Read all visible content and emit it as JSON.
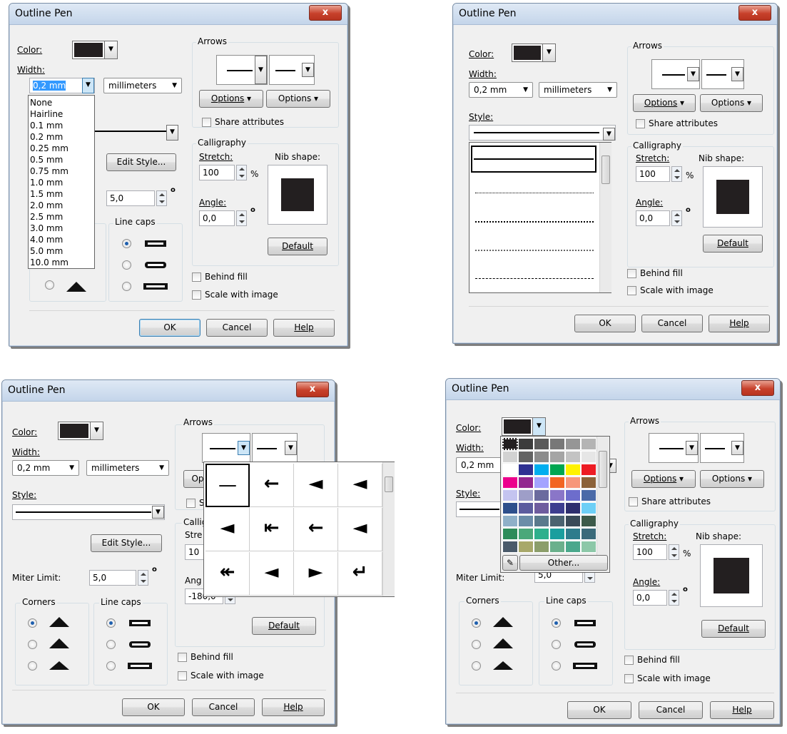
{
  "panels": {
    "width_list": {
      "title": "Outline Pen",
      "color_label": "Color:",
      "width_label": "Width:",
      "width_value": "0,2 mm",
      "units": "millimeters",
      "width_options": [
        "None",
        "Hairline",
        "0.1 mm",
        "0.2 mm",
        "0.25 mm",
        "0.5 mm",
        "0.75 mm",
        "1.0 mm",
        "1.5 mm",
        "2.0 mm",
        "2.5 mm",
        "3.0 mm",
        "4.0 mm",
        "5.0 mm",
        "10.0 mm"
      ],
      "edit_style": "Edit Style...",
      "miter_value": "5,0",
      "line_caps": "Line caps",
      "arrows": "Arrows",
      "options1": "Options",
      "options2": "Options",
      "share": "Share attributes",
      "calligraphy": "Calligraphy",
      "stretch": "Stretch:",
      "stretch_value": "100",
      "percent": "%",
      "nib_shape": "Nib shape:",
      "angle": "Angle:",
      "angle_value": "0,0",
      "degree": "o",
      "default": "Default",
      "behind_fill": "Behind fill",
      "scale": "Scale with image",
      "ok": "OK",
      "cancel": "Cancel",
      "help": "Help",
      "close": "x"
    },
    "style_list": {
      "title": "Outline Pen",
      "color_label": "Color:",
      "width_label": "Width:",
      "width_value": "0,2 mm",
      "units": "millimeters",
      "style_label": "Style:",
      "arrows": "Arrows",
      "options1": "Options",
      "options2": "Options",
      "share": "Share attributes",
      "calligraphy": "Calligraphy",
      "stretch": "Stretch:",
      "stretch_value": "100",
      "percent": "%",
      "nib_shape": "Nib shape:",
      "angle": "Angle:",
      "angle_value": "0,0",
      "degree": "o",
      "default": "Default",
      "behind_fill": "Behind fill",
      "scale": "Scale with image",
      "ok": "OK",
      "cancel": "Cancel",
      "help": "Help",
      "close": "x"
    },
    "arrow_picker": {
      "title": "Outline Pen",
      "color_label": "Color:",
      "width_label": "Width:",
      "width_value": "0,2 mm",
      "units": "millimeters",
      "style_label": "Style:",
      "edit_style": "Edit Style...",
      "miter_label": "Miter Limit:",
      "miter_value": "5,0",
      "degree": "o",
      "corners": "Corners",
      "line_caps": "Line caps",
      "arrows": "Arrows",
      "op_partial": "Op",
      "s_partial": "S",
      "calli_partial": "Callig",
      "stre_partial": "Stre",
      "ten_partial": "10",
      "ang_partial": "Ang",
      "angle_value": "-180,0",
      "default": "Default",
      "behind_fill": "Behind fill",
      "scale": "Scale with image",
      "ok": "OK",
      "cancel": "Cancel",
      "help": "Help",
      "close": "x",
      "arrowheads": [
        "—",
        "←",
        "◄",
        "◄",
        "◄",
        "⇤",
        "←",
        "◄",
        "↞",
        "◄",
        "►",
        "↵"
      ]
    },
    "color_picker": {
      "title": "Outline Pen",
      "color_label": "Color:",
      "width_label": "Width:",
      "width_value": "0,2 mm",
      "style_label": "Style:",
      "other": "Other...",
      "miter_label": "Miter Limit:",
      "miter_value": "5,0",
      "degree": "o",
      "corners": "Corners",
      "line_caps": "Line caps",
      "arrows": "Arrows",
      "options1": "Options",
      "options2": "Options",
      "share": "Share attributes",
      "calligraphy": "Calligraphy",
      "stretch": "Stretch:",
      "stretch_value": "100",
      "percent": "%",
      "nib_shape": "Nib shape:",
      "angle": "Angle:",
      "angle_value": "0,0",
      "default": "Default",
      "behind_fill": "Behind fill",
      "scale": "Scale with image",
      "ok": "OK",
      "cancel": "Cancel",
      "help": "Help",
      "close": "x",
      "palette": [
        "#231f20",
        "#3c3c3c",
        "#5a5a5a",
        "#787878",
        "#969696",
        "#b4b4b4",
        "#d2d2d2",
        "#646464",
        "#8c8c8c",
        "#a5a5a5",
        "#c3c3c3",
        "#e6e6e6",
        "#ffffff",
        "#2e3192",
        "#00aeef",
        "#00a651",
        "#fff200",
        "#ed1c24",
        "#ec008c",
        "#92278f",
        "#a3a3ff",
        "#f26522",
        "#f7977a",
        "#8c6239",
        "#c4c4f0",
        "#9e9ec8",
        "#6b6b9e",
        "#8a76c8",
        "#6d6dcc",
        "#4a6aa8",
        "#2d4f8c",
        "#5c5c9e",
        "#6e5c9e",
        "#3d3d8f",
        "#2e2e6e",
        "#6dcff6",
        "#8fb0c8",
        "#6b8da8",
        "#5a7a8c",
        "#4a6270",
        "#3a4a58",
        "#3c5a4a",
        "#2e8c5a",
        "#4aa87a",
        "#2eb08c",
        "#1a9e9e",
        "#2e7c8c",
        "#3a6a7a",
        "#4a5a6a",
        "#a8a86a",
        "#8c9e6a",
        "#6ab08c",
        "#4aa88c",
        "#8cc8a8",
        "#a8c8b0",
        "#b0d0a0"
      ]
    }
  }
}
